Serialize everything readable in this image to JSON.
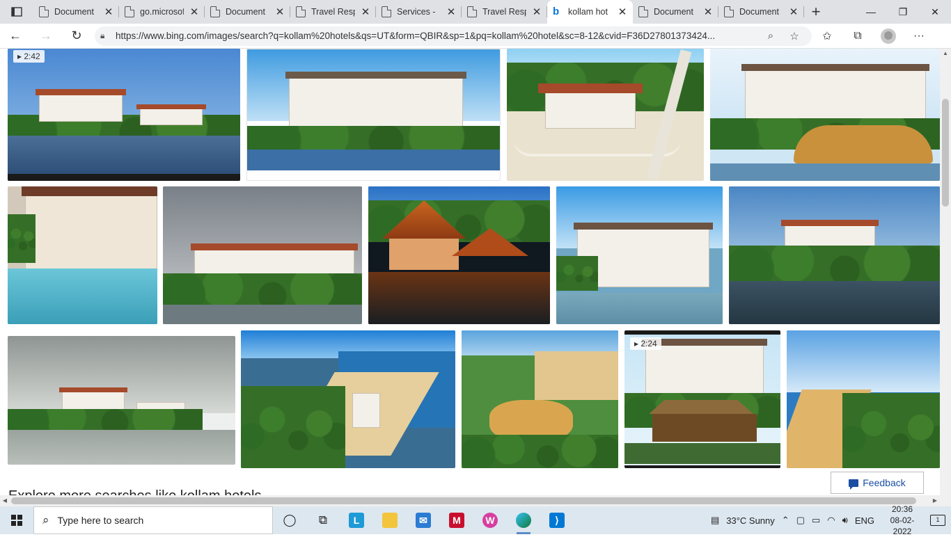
{
  "browser": {
    "tabs": [
      {
        "title": "Document",
        "icon": "page-icon",
        "active": false
      },
      {
        "title": "go.microsoft",
        "icon": "page-icon",
        "active": false
      },
      {
        "title": "Document",
        "icon": "page-icon",
        "active": false
      },
      {
        "title": "Travel Resp",
        "icon": "page-icon",
        "active": false
      },
      {
        "title": "Services - ",
        "icon": "page-icon",
        "active": false
      },
      {
        "title": "Travel Resp",
        "icon": "page-icon",
        "active": false
      },
      {
        "title": "kollam hot",
        "icon": "bing-icon",
        "active": true
      },
      {
        "title": "Document",
        "icon": "page-icon",
        "active": false
      },
      {
        "title": "Document",
        "icon": "page-icon",
        "active": false
      }
    ],
    "new_tab_glyph": "+",
    "close_glyph": "✕",
    "url": "https://www.bing.com/images/search?q=kollam%20hotels&qs=UT&form=QBIR&sp=1&pq=kollam%20hotel&sc=8-12&cvid=F36D27801373424..."
  },
  "results": {
    "video_badges": [
      "2:42",
      "2:24"
    ],
    "related_heading": "Explore more searches like kollam hotels"
  },
  "feedback_label": "Feedback",
  "taskbar": {
    "search_placeholder": "Type here to search",
    "weather": "33°C  Sunny",
    "language": "ENG",
    "time": "20:36",
    "date": "08-02-2022",
    "notification_count": "1"
  },
  "colors": {
    "tabstrip_bg": "#dfe1e5",
    "taskbar_bg": "#dde7f0",
    "link_blue": "#1a4ea3",
    "bing_blue": "#0a74da"
  }
}
